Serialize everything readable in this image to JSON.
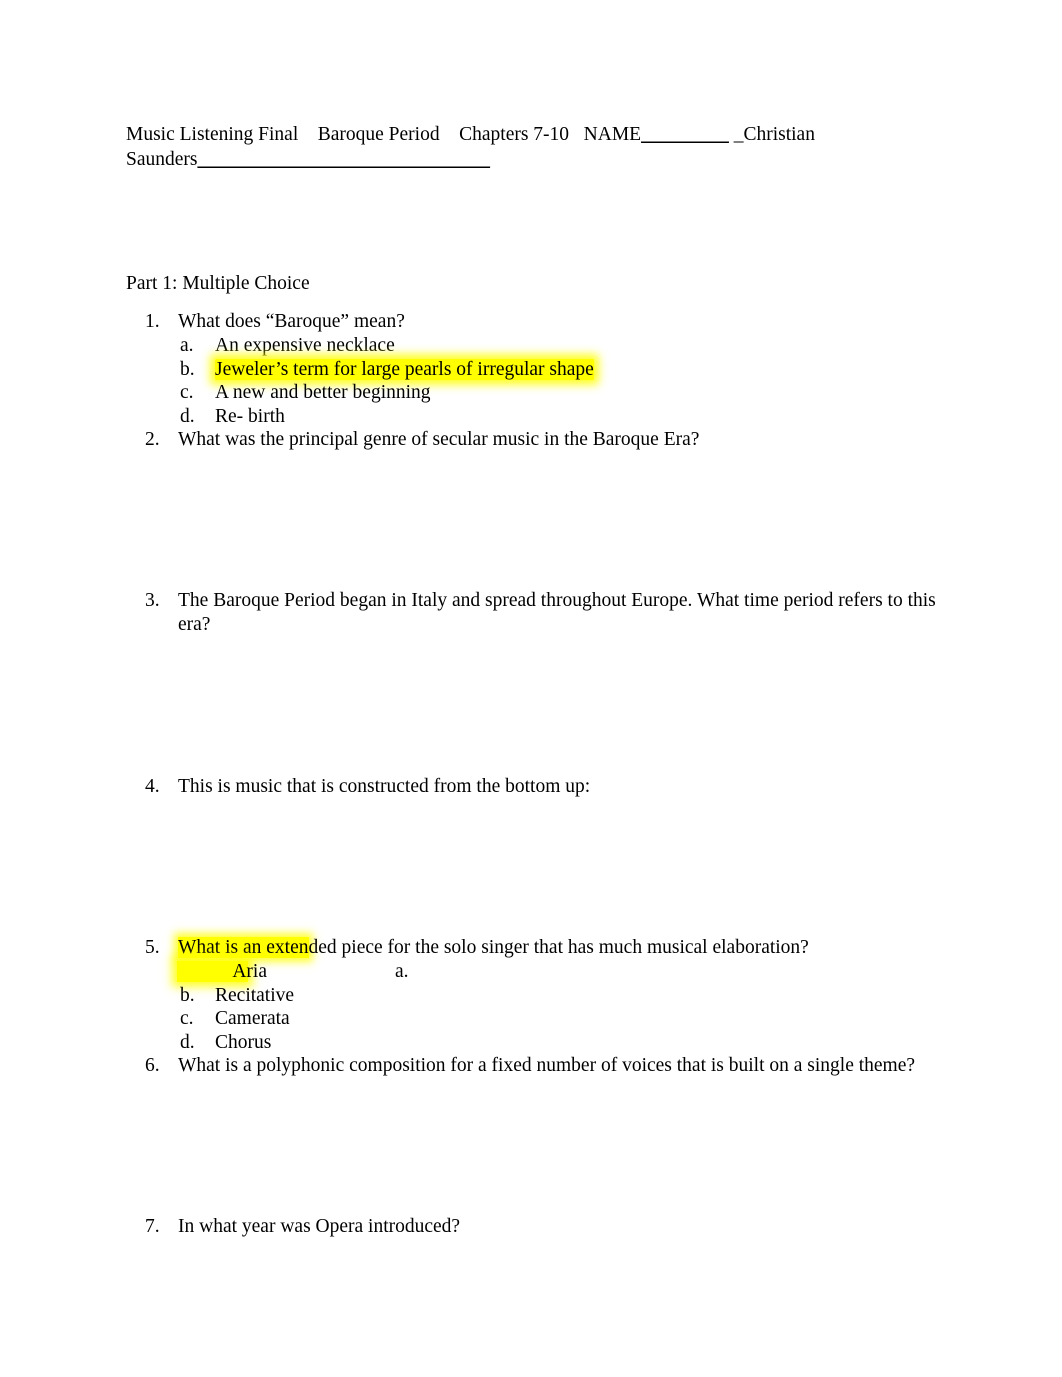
{
  "document": {
    "header": {
      "title_segments": [
        "Music Listening Final",
        "Baroque Period",
        "Chapters 7-10",
        "NAME"
      ],
      "name_blank": "_________",
      "student_name_line1": " _Christian",
      "student_name_line2": "Saunders",
      "name_underline_tail": "______________________________",
      "full_text": "Music Listening Final    Baroque Period    Chapters 7-10   NAME_________ _Christian Saunders______________________________"
    },
    "part_title": "Part 1: Multiple Choice",
    "questions": [
      {
        "number": "1.",
        "text": "What does “Baroque” mean?",
        "options": [
          {
            "letter": "a.",
            "text": "An expensive necklace",
            "highlighted": false
          },
          {
            "letter": "b.",
            "text": "Jeweler’s term for large pearls of irregular shape",
            "highlighted": true
          },
          {
            "letter": "c.",
            "text": "A new and better beginning",
            "highlighted": false
          },
          {
            "letter": "d.",
            "text": "Re- birth",
            "highlighted": false
          }
        ]
      },
      {
        "number": "2.",
        "text": "What was the principal genre of secular music in the Baroque Era?",
        "options": []
      },
      {
        "number": "3.",
        "text": "The Baroque Period began in Italy and spread throughout Europe. What time period refers to this era?",
        "options": []
      },
      {
        "number": "4.",
        "text": "This is music that is constructed from the bottom up:",
        "options": []
      },
      {
        "number": "5.",
        "text_highlighted_part": "What is an exten",
        "text_plain_part": "ded piece for the solo singer that has much musical elaboration?",
        "text": "What is an extended piece for the solo singer that has much musical elaboration?",
        "options": [
          {
            "letter": "a.",
            "text": "Aria",
            "highlighted": true
          },
          {
            "letter": "b.",
            "text": "Recitative",
            "highlighted": false
          },
          {
            "letter": "c.",
            "text": "Camerata",
            "highlighted": false
          },
          {
            "letter": "d.",
            "text": "Chorus",
            "highlighted": false
          }
        ]
      },
      {
        "number": "6.",
        "text": "What is a polyphonic composition for a fixed number of voices that is built on a single theme?",
        "options": []
      },
      {
        "number": "7.",
        "text": "In what year was Opera introduced?",
        "options": []
      }
    ]
  },
  "style": {
    "highlight_color": "#ffff00",
    "text_color": "#000000",
    "page_background": "#ffffff"
  }
}
